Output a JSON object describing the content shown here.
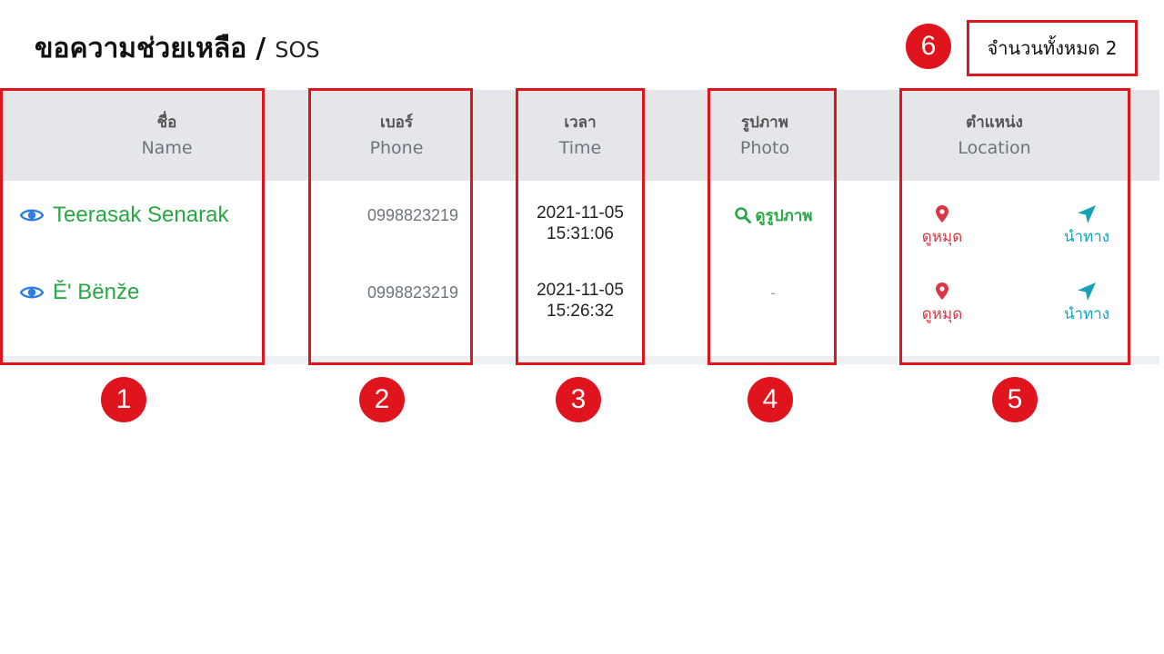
{
  "header": {
    "title": "ขอความช่วยเหลือ",
    "separator": "/",
    "subtitle": "SOS",
    "total_label": "จำนวนทั้งหมด 2"
  },
  "columns": [
    {
      "th": "ชื่อ",
      "en": "Name"
    },
    {
      "th": "เบอร์",
      "en": "Phone"
    },
    {
      "th": "เวลา",
      "en": "Time"
    },
    {
      "th": "รูปภาพ",
      "en": "Photo"
    },
    {
      "th": "ตำแหน่ง",
      "en": "Location"
    }
  ],
  "rows": [
    {
      "name": "Teerasak Senarak",
      "phone": "0998823219",
      "date": "2021-11-05",
      "clock": "15:31:06",
      "photo": "ดูรูปภาพ",
      "pin": "ดูหมุด",
      "nav": "นำทาง"
    },
    {
      "name": "Ě' Bënže",
      "phone": "0998823219",
      "date": "2021-11-05",
      "clock": "15:26:32",
      "photo": "-",
      "pin": "ดูหมุด",
      "nav": "นำทาง"
    }
  ],
  "badges": [
    "1",
    "2",
    "3",
    "4",
    "5",
    "6"
  ],
  "colors": {
    "annotation": "#e0141c",
    "link_green": "#28a745",
    "pin_red": "#dc3545",
    "nav_teal": "#17a2b8",
    "eye_blue": "#2f7de1"
  },
  "icons": {
    "eye": "eye-icon",
    "search": "search-icon",
    "pin": "map-pin-icon",
    "navigate": "navigation-arrow-icon"
  }
}
